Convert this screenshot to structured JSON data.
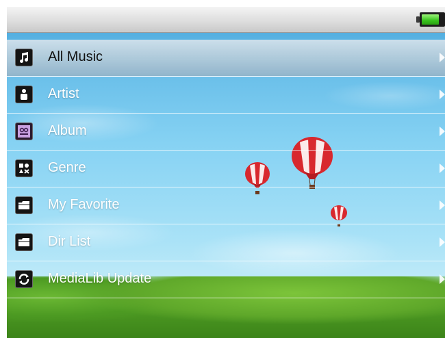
{
  "status": {
    "battery_level": 0.8,
    "battery_color": "#37c21d"
  },
  "menu": {
    "items": [
      {
        "label": "All Music",
        "icon": "music-note-icon",
        "selected": true
      },
      {
        "label": "Artist",
        "icon": "person-icon",
        "selected": false
      },
      {
        "label": "Album",
        "icon": "album-icon",
        "selected": false
      },
      {
        "label": "Genre",
        "icon": "genre-shapes-icon",
        "selected": false
      },
      {
        "label": "My Favorite",
        "icon": "folder-icon",
        "selected": false
      },
      {
        "label": "Dir List",
        "icon": "folder-icon",
        "selected": false
      },
      {
        "label": "MediaLib Update",
        "icon": "refresh-icon",
        "selected": false
      }
    ]
  },
  "colors": {
    "highlight": "#b8ccd8",
    "sky": "#86d2f3",
    "grass": "#4f9c24"
  }
}
